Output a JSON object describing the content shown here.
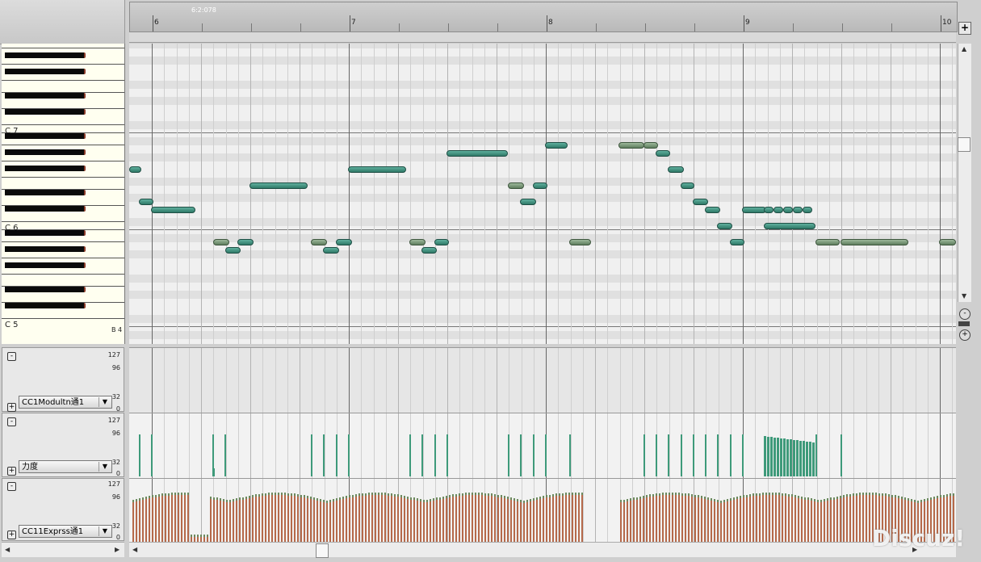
{
  "ruler": {
    "position_label": "6:2:078",
    "bars": [
      {
        "label": "6"
      },
      {
        "label": "7"
      },
      {
        "label": "8"
      },
      {
        "label": "9"
      },
      {
        "label": "10"
      }
    ]
  },
  "keyboard": {
    "octave_labels": [
      "C 7",
      "C 6",
      "C 5"
    ],
    "bottom_label": "B 4"
  },
  "buttons": {
    "add_lane": "+",
    "zoom_in": "+",
    "zoom_out": "-",
    "collapse": "-",
    "expand": "+"
  },
  "cc_lanes": [
    {
      "name": "CC1Modultn通1",
      "scale": [
        "127",
        "96",
        "32",
        "0"
      ]
    },
    {
      "name": "力度",
      "scale": [
        "127",
        "96",
        "32",
        "0"
      ]
    },
    {
      "name": "CC11Exprss通1",
      "scale": [
        "127",
        "96",
        "32",
        "0"
      ]
    }
  ],
  "watermark": "Discuz!",
  "colors": {
    "note": "#3f8f7c",
    "note_muted": "#7f9f7d",
    "velocity": "#3e9a7a",
    "expression": "#b5694a"
  }
}
